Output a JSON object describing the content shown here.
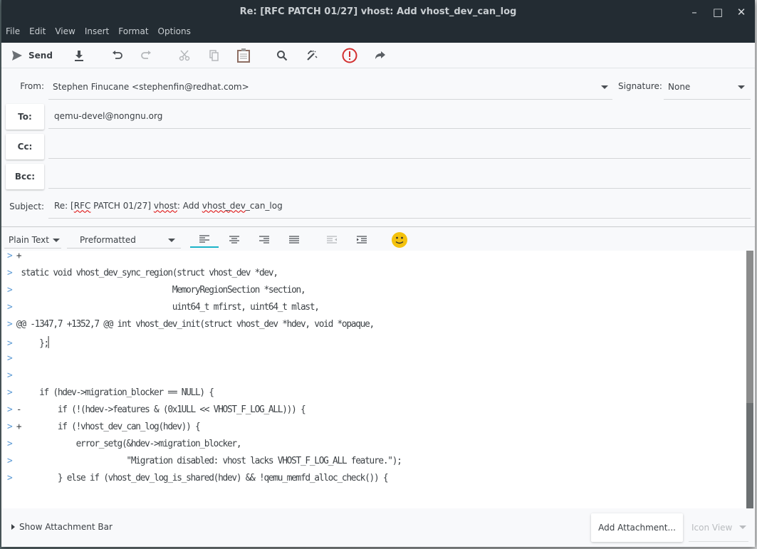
{
  "window": {
    "title": "Re: [RFC PATCH 01/27] vhost: Add vhost_dev_can_log",
    "controls": [
      "minimize",
      "maximize",
      "close"
    ]
  },
  "menubar": [
    "File",
    "Edit",
    "View",
    "Insert",
    "Format",
    "Options"
  ],
  "toolbar": {
    "send_label": "Send",
    "icons": [
      "send-icon",
      "save-draft-icon",
      "undo-icon",
      "redo-icon",
      "cut-icon",
      "copy-icon",
      "paste-icon",
      "find-icon",
      "spellcheck-icon",
      "priority-icon",
      "forward-icon"
    ]
  },
  "header": {
    "from_label": "From:",
    "from_value": "Stephen Finucane <stephenfin@redhat.com>",
    "signature_label": "Signature:",
    "signature_value": "None",
    "to_label": "To:",
    "to_value": "qemu-devel@nongnu.org",
    "cc_label": "Cc:",
    "cc_value": "",
    "bcc_label": "Bcc:",
    "bcc_value": "",
    "subject_label": "Subject:",
    "subject_parts": [
      "Re: [",
      "RFC",
      " PATCH 01/27] ",
      "vhost",
      ": Add ",
      "vhost_dev",
      "_can_log"
    ]
  },
  "format_bar": {
    "mode": "Plain Text",
    "paragraph_style": "Preformatted",
    "alignment_active": "left",
    "emoji": "smiley-icon"
  },
  "editor": {
    "lines": [
      {
        "q": ">",
        "t": " +"
      },
      {
        "q": ">",
        "t": "  static void vhost_dev_sync_region(struct vhost_dev *dev,"
      },
      {
        "q": ">",
        "t": "                                   MemoryRegionSection *section,"
      },
      {
        "q": ">",
        "t": "                                   uint64_t mfirst, uint64_t mlast,"
      },
      {
        "q": ">",
        "t": " @@ -1347,7 +1352,7 @@ int vhost_dev_init(struct vhost_dev *hdev, void *opaque,"
      },
      {
        "q": ">",
        "t": "      };",
        "caret": true
      },
      {
        "q": ">",
        "t": ""
      },
      {
        "q": ">",
        "t": ""
      },
      {
        "q": ">",
        "t": "      if (hdev->migration_blocker == NULL) {"
      },
      {
        "q": ">",
        "t": " -        if (!(hdev->features & (0x1ULL << VHOST_F_LOG_ALL))) {"
      },
      {
        "q": ">",
        "t": " +        if (!vhost_dev_can_log(hdev)) {"
      },
      {
        "q": ">",
        "t": "              error_setg(&hdev->migration_blocker,"
      },
      {
        "q": ">",
        "t": "                         \"Migration disabled: vhost lacks VHOST_F_LOG_ALL feature.\");"
      },
      {
        "q": ">",
        "t": "          } else if (vhost_dev_log_is_shared(hdev) && !qemu_memfd_alloc_check()) {"
      }
    ]
  },
  "attachment_bar": {
    "show_label": "Show Attachment Bar",
    "add_label": "Add Attachment...",
    "view_mode": "Icon View"
  },
  "colors": {
    "titlebar": "#232c33",
    "quote_marker": "#5c9ad4",
    "accent": "#1cb3c8",
    "priority": "#d32f2f",
    "emoji": "#f4c20d"
  }
}
